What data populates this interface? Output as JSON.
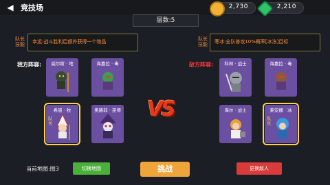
{
  "header": {
    "back_icon": "back-arrow-icon",
    "title": "竞技场"
  },
  "currency": {
    "gold": "2,730",
    "gem": "2,210",
    "gold_color": "#f2b233",
    "gem_color": "#2fc46b"
  },
  "floor": "层数:5",
  "ally_skill": {
    "tag": "队长技能",
    "text": "幸运:战斗胜利后额外获得一个物品"
  },
  "enemy_skill": {
    "tag": "队长技能",
    "text": "寒冰:全队普攻10%概率[冰冻]目标"
  },
  "ally": {
    "label": "我方阵容:",
    "heroes": [
      {
        "name": "威尔斯 · 地",
        "leader": false
      },
      {
        "name": "海嘉拉 · 毒",
        "leader": false
      },
      {
        "name": "希崽 · 牧",
        "leader": true,
        "leader_tag": "队长"
      },
      {
        "name": "奥路菲 · 巫师",
        "leader": false
      }
    ]
  },
  "enemy": {
    "label": "敌方阵容:",
    "heroes": [
      {
        "name": "科林 · 战士",
        "leader": false
      },
      {
        "name": "海嘉拉 · 毒",
        "leader": false
      },
      {
        "name": "海尔 · 战士",
        "leader": false
      },
      {
        "name": "莱安娜 · 冰",
        "leader": true,
        "leader_tag": "队长"
      }
    ]
  },
  "vs_text": "VS",
  "bottom": {
    "map_text": "当前地图:图3",
    "switch_map": "切换地图",
    "fight": "挑战",
    "change_enemy": "更换敌人"
  }
}
